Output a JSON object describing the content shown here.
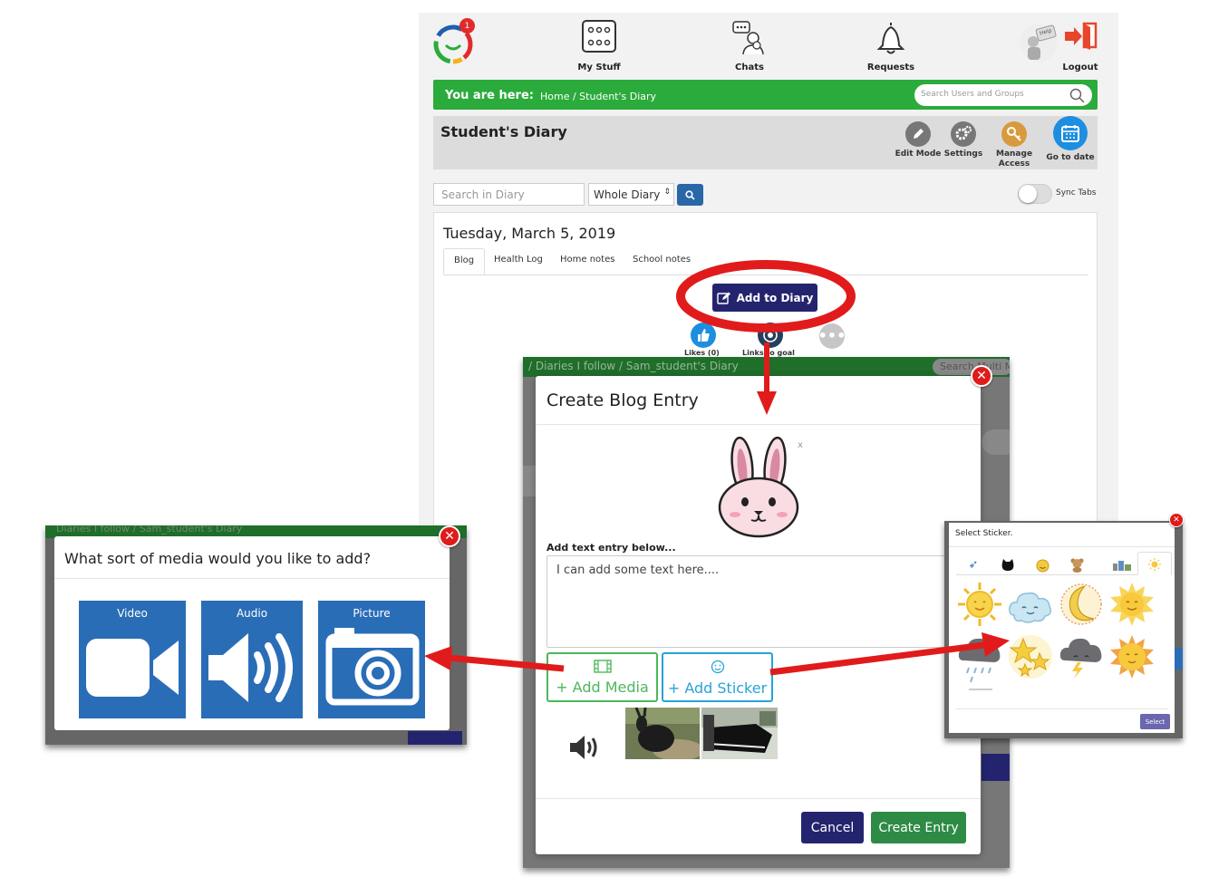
{
  "nav": {
    "notification_count": "1",
    "my_stuff": "My Stuff",
    "chats": "Chats",
    "requests": "Requests",
    "help": "Help",
    "logout": "Logout"
  },
  "breadcrumb": {
    "prefix": "You are here:",
    "path": "Home  /  Student's Diary",
    "search_placeholder": "Search Users and Groups"
  },
  "page": {
    "title": "Student's Diary",
    "tools": [
      "Edit Mode",
      "Settings",
      "Manage Access",
      "Go to date"
    ]
  },
  "diary_search": {
    "placeholder": "Search in Diary",
    "scope": "Whole Diary",
    "sync_label": "Sync Tabs"
  },
  "diary": {
    "date": "Tuesday, March 5, 2019",
    "tabs": [
      "Blog",
      "Health Log",
      "Home notes",
      "School notes"
    ],
    "add_button": "Add to Diary",
    "likes": "Likes (0)",
    "links": "Links to goal"
  },
  "bg_page": {
    "breadcrumb": "/ Diaries I follow / Sam_student's Diary",
    "search": "Search Multi M..."
  },
  "blog_modal": {
    "title": "Create Blog Entry",
    "text_label": "Add text entry below...",
    "text_value": "I can add some text here....",
    "add_media": "+ Add Media",
    "add_sticker": "+ Add Sticker",
    "cancel": "Cancel",
    "create": "Create Entry",
    "close_glyph": "✕",
    "sticker_remove": "x"
  },
  "media_modal": {
    "bg_breadcrumb": "Diaries I follow / Sam_student's Diary",
    "title": "What sort of media would you like to add?",
    "options": [
      "Video",
      "Audio",
      "Picture"
    ]
  },
  "sticker_modal": {
    "title": "Select Sticker.",
    "select": "Select"
  },
  "colors": {
    "green": "#2bab3b",
    "navy": "#24246e",
    "red_annotation": "#e11b1b",
    "media_blue": "#2a6db7"
  }
}
